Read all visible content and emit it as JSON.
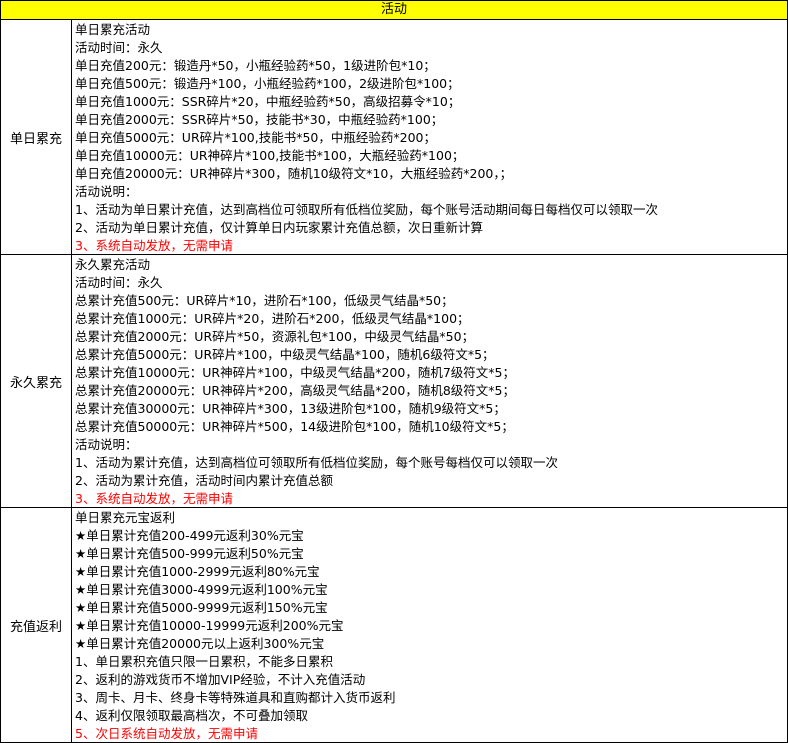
{
  "header": {
    "title": "活动"
  },
  "sections": [
    {
      "label": "单日累充",
      "lines": [
        "单日累充活动",
        "活动时间：永久",
        "单日充值200元：锻造丹*50，小瓶经验药*50，1级进阶包*10；",
        "单日充值500元：锻造丹*100，小瓶经验药*100，2级进阶包*100；",
        "单日充值1000元：SSR碎片*20，中瓶经验药*50，高级招募令*10；",
        "单日充值2000元：SSR碎片*50，技能书*30，中瓶经验药*100；",
        "单日充值5000元：UR碎片*100,技能书*50，中瓶经验药*200；",
        "单日充值10000元：UR神碎片*100,技能书*100，大瓶经验药*100；",
        "单日充值20000元：UR神碎片*300，随机10级符文*10，大瓶经验药*200，；",
        "活动说明：",
        "1、活动为单日累计充值，达到高档位可领取所有低档位奖励，每个账号活动期间每日每档仅可以领取一次",
        "2、活动为单日累计充值，仅计算单日内玩家累计充值总额，次日重新计算"
      ],
      "red_line": "3、系统自动发放，无需申请"
    },
    {
      "label": "永久累充",
      "lines": [
        "永久累充活动",
        "活动时间：永久",
        "总累计充值500元：UR碎片*10，进阶石*100，低级灵气结晶*50；",
        "总累计充值1000元：UR碎片*20，进阶石*200，低级灵气结晶*100；",
        "总累计充值2000元：UR碎片*50，资源礼包*100，中级灵气结晶*50；",
        "总累计充值5000元：UR碎片*100，中级灵气结晶*100，随机6级符文*5；",
        "总累计充值10000元：UR神碎片*100，中级灵气结晶*200，随机7级符文*5；",
        "总累计充值20000元：UR神碎片*200，高级灵气结晶*200，随机8级符文*5；",
        "总累计充值30000元：UR神碎片*300，13级进阶包*100，随机9级符文*5；",
        "总累计充值50000元：UR神碎片*500，14级进阶包*100，随机10级符文*5；",
        "活动说明：",
        "1、活动为累计充值，达到高档位可领取所有低档位奖励，每个账号每档仅可以领取一次",
        "2、活动为累计充值，活动时间内累计充值总额"
      ],
      "red_line": "3、系统自动发放，无需申请"
    },
    {
      "label": "充值返利",
      "lines": [
        "单日累充元宝返利",
        "★单日累计充值200-499元返利30%元宝",
        "★单日累计充值500-999元返利50%元宝",
        "★单日累计充值1000-2999元返利80%元宝",
        "★单日累计充值3000-4999元返利100%元宝",
        "★单日累计充值5000-9999元返利150%元宝",
        "★单日累计充值10000-19999元返利200%元宝",
        "★单日累计充值20000元以上返利300%元宝",
        "1、单日累积充值只限一日累积，不能多日累积",
        "2、返利的游戏货币不增加VIP经验，不计入充值活动",
        "3、周卡、月卡、终身卡等特殊道具和直购都计入货币返利",
        "4、返利仅限领取最高档次，不可叠加领取"
      ],
      "red_line": "5、次日系统自动发放，无需申请"
    }
  ]
}
